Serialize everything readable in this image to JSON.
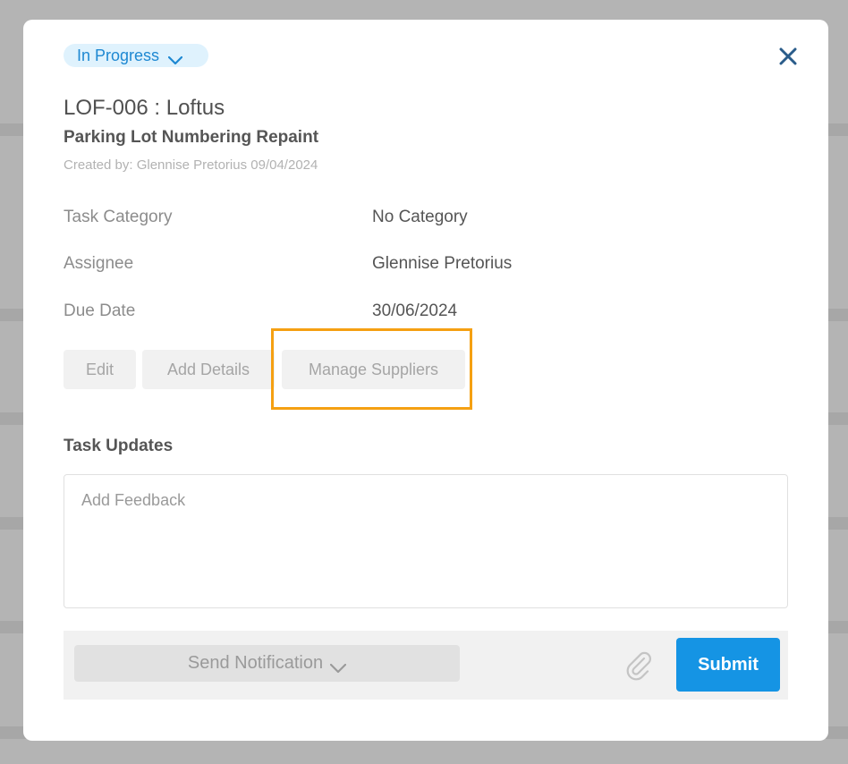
{
  "status": {
    "label": "In Progress"
  },
  "task": {
    "id_title": "LOF-006 : Loftus",
    "name": "Parking Lot Numbering Repaint",
    "created_by": "Created by: Glennise Pretorius 09/04/2024"
  },
  "fields": [
    {
      "label": "Task Category",
      "value": "No Category"
    },
    {
      "label": "Assignee",
      "value": "Glennise Pretorius"
    },
    {
      "label": "Due Date",
      "value": "30/06/2024"
    }
  ],
  "actions": {
    "edit": "Edit",
    "add_details": "Add Details",
    "manage_suppliers": "Manage Suppliers"
  },
  "updates": {
    "title": "Task Updates",
    "feedback_placeholder": "Add Feedback",
    "send_notification": "Send Notification",
    "submit": "Submit"
  },
  "colors": {
    "accent": "#1594e4",
    "status_text": "#1e88d2",
    "status_bg": "#dff2fd",
    "highlight": "#f5a012",
    "close_icon": "#2a5c8a"
  },
  "icons": {
    "status_dropdown": "chevron-down-icon",
    "close": "close-icon",
    "notification_dropdown": "chevron-down-icon",
    "attach": "paperclip-icon"
  }
}
